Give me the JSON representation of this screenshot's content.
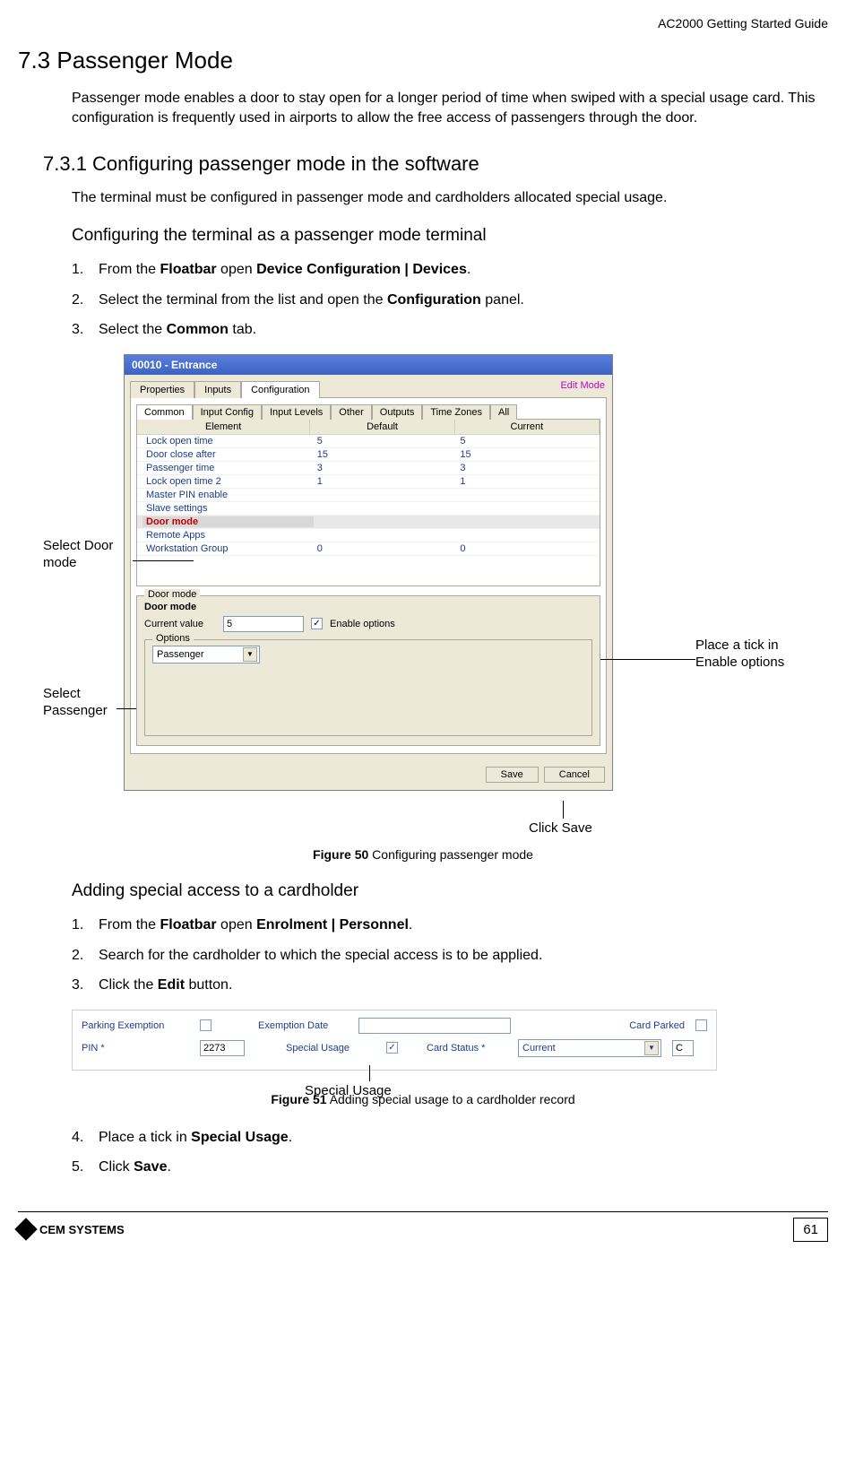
{
  "header": {
    "doc_title": "AC2000 Getting Started Guide"
  },
  "section": {
    "h1": "7.3  Passenger Mode",
    "intro": "Passenger mode enables a door to stay open for a longer period of time when swiped with a special usage card. This configuration is frequently used in airports to allow the free access of passengers through the door.",
    "h2": "7.3.1  Configuring passenger mode in the software",
    "sub": "The terminal must be configured in passenger mode and cardholders allocated special usage.",
    "h3a": "Configuring the terminal as a passenger mode terminal",
    "stepsA": [
      {
        "n": "1.",
        "pre": "From the ",
        "b1": "Floatbar",
        "mid": " open ",
        "b2": "Device Configuration | Devices",
        "post": "."
      },
      {
        "n": "2.",
        "pre": "Select the terminal from the list and open the ",
        "b1": "Configuration",
        "mid": " panel.",
        "b2": "",
        "post": ""
      },
      {
        "n": "3.",
        "pre": "Select the ",
        "b1": "Common",
        "mid": " tab.",
        "b2": "",
        "post": ""
      }
    ],
    "h3b": "Adding special access to a cardholder",
    "stepsB": [
      {
        "n": "1.",
        "pre": "From the ",
        "b1": "Floatbar",
        "mid": " open ",
        "b2": "Enrolment | Personnel",
        "post": "."
      },
      {
        "n": "2.",
        "pre": "Search for the cardholder to which the special access is to be applied.",
        "b1": "",
        "mid": "",
        "b2": "",
        "post": ""
      },
      {
        "n": "3.",
        "pre": "Click the ",
        "b1": "Edit",
        "mid": " button.",
        "b2": "",
        "post": ""
      }
    ],
    "stepsC": [
      {
        "n": "4.",
        "pre": "Place a tick in ",
        "b1": "Special Usage",
        "mid": ".",
        "b2": "",
        "post": ""
      },
      {
        "n": "5.",
        "pre": "Click ",
        "b1": "Save",
        "mid": ".",
        "b2": "",
        "post": ""
      }
    ]
  },
  "callouts": {
    "door_mode": "Select Door mode",
    "passenger": "Select Passenger",
    "enable": "Place a tick in Enable options",
    "save": "Click Save",
    "special_usage": "Special Usage"
  },
  "win": {
    "title": "00010 - Entrance",
    "edit_mode": "Edit Mode",
    "top_tabs": [
      "Properties",
      "Inputs",
      "Configuration"
    ],
    "inner_tabs": [
      "Common",
      "Input Config",
      "Input Levels",
      "Other",
      "Outputs",
      "Time Zones",
      "All"
    ],
    "grid_headers": [
      "Element",
      "Default",
      "Current"
    ],
    "rows": [
      {
        "el": "Lock open time",
        "def": "5",
        "cur": "5"
      },
      {
        "el": "Door close after",
        "def": "15",
        "cur": "15"
      },
      {
        "el": "Passenger time",
        "def": "3",
        "cur": "3"
      },
      {
        "el": "Lock open time 2",
        "def": "1",
        "cur": "1"
      },
      {
        "el": "Master PIN enable",
        "def": "",
        "cur": ""
      },
      {
        "el": "Slave settings",
        "def": "",
        "cur": ""
      },
      {
        "el": "Door mode",
        "def": "",
        "cur": ""
      },
      {
        "el": "Remote Apps",
        "def": "",
        "cur": ""
      },
      {
        "el": "Workstation Group",
        "def": "0",
        "cur": "0"
      }
    ],
    "door_mode": {
      "legend": "Door mode",
      "label": "Door mode",
      "cv_label": "Current value",
      "cv": "5",
      "enable_label": "Enable options"
    },
    "options": {
      "legend": "Options",
      "value": "Passenger"
    },
    "buttons": {
      "save": "Save",
      "cancel": "Cancel"
    }
  },
  "fig1": {
    "b": "Figure 50",
    "t": " Configuring passenger mode"
  },
  "shot2": {
    "row1": {
      "parking": "Parking Exemption",
      "exemption": "Exemption Date",
      "exemption_val": "",
      "card_parked": "Card Parked"
    },
    "row2": {
      "pin": "PIN *",
      "pin_val": "2273",
      "special": "Special Usage",
      "status": "Card Status *",
      "status_val": "Current",
      "c": "C"
    }
  },
  "fig2": {
    "b": "Figure 51",
    "t": " Adding special usage to a cardholder record"
  },
  "footer": {
    "logo": "CEM SYSTEMS",
    "page": "61"
  }
}
